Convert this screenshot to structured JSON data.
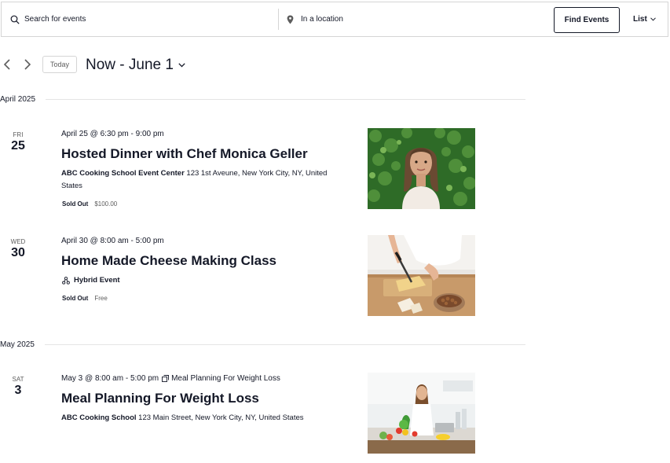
{
  "search": {
    "keyword_placeholder": "Search for events",
    "location_placeholder": "In a location",
    "find_button": "Find Events",
    "view_label": "List"
  },
  "datenav": {
    "today_label": "Today",
    "range_label": "Now - June 1"
  },
  "months": [
    "April 2025",
    "May 2025"
  ],
  "events": [
    {
      "weekday": "FRI",
      "day": "25",
      "datetime": "April 25 @ 6:30 pm - 9:00 pm",
      "title": "Hosted Dinner with Chef Monica Geller",
      "venue_name": "ABC Cooking School Event Center",
      "venue_address": "123 1st Aveune, New York City, NY, United States",
      "sold_out": "Sold Out",
      "cost": "$100.00",
      "image_icon": "woman-portrait-image"
    },
    {
      "weekday": "WED",
      "day": "30",
      "datetime": "April 30 @ 8:00 am - 5:00 pm",
      "title": "Home Made Cheese Making Class",
      "hybrid_label": "Hybrid Event",
      "sold_out": "Sold Out",
      "cost": "Free",
      "image_icon": "cheese-cutting-image"
    },
    {
      "weekday": "SAT",
      "day": "3",
      "datetime": "May 3 @ 8:00 am - 5:00 pm",
      "series_label": "Meal Planning For Weight Loss",
      "title": "Meal Planning For Weight Loss",
      "venue_name": "ABC Cooking School",
      "venue_address": "123 Main Street, New York City, NY, United States",
      "image_icon": "kitchen-cooking-image"
    }
  ]
}
